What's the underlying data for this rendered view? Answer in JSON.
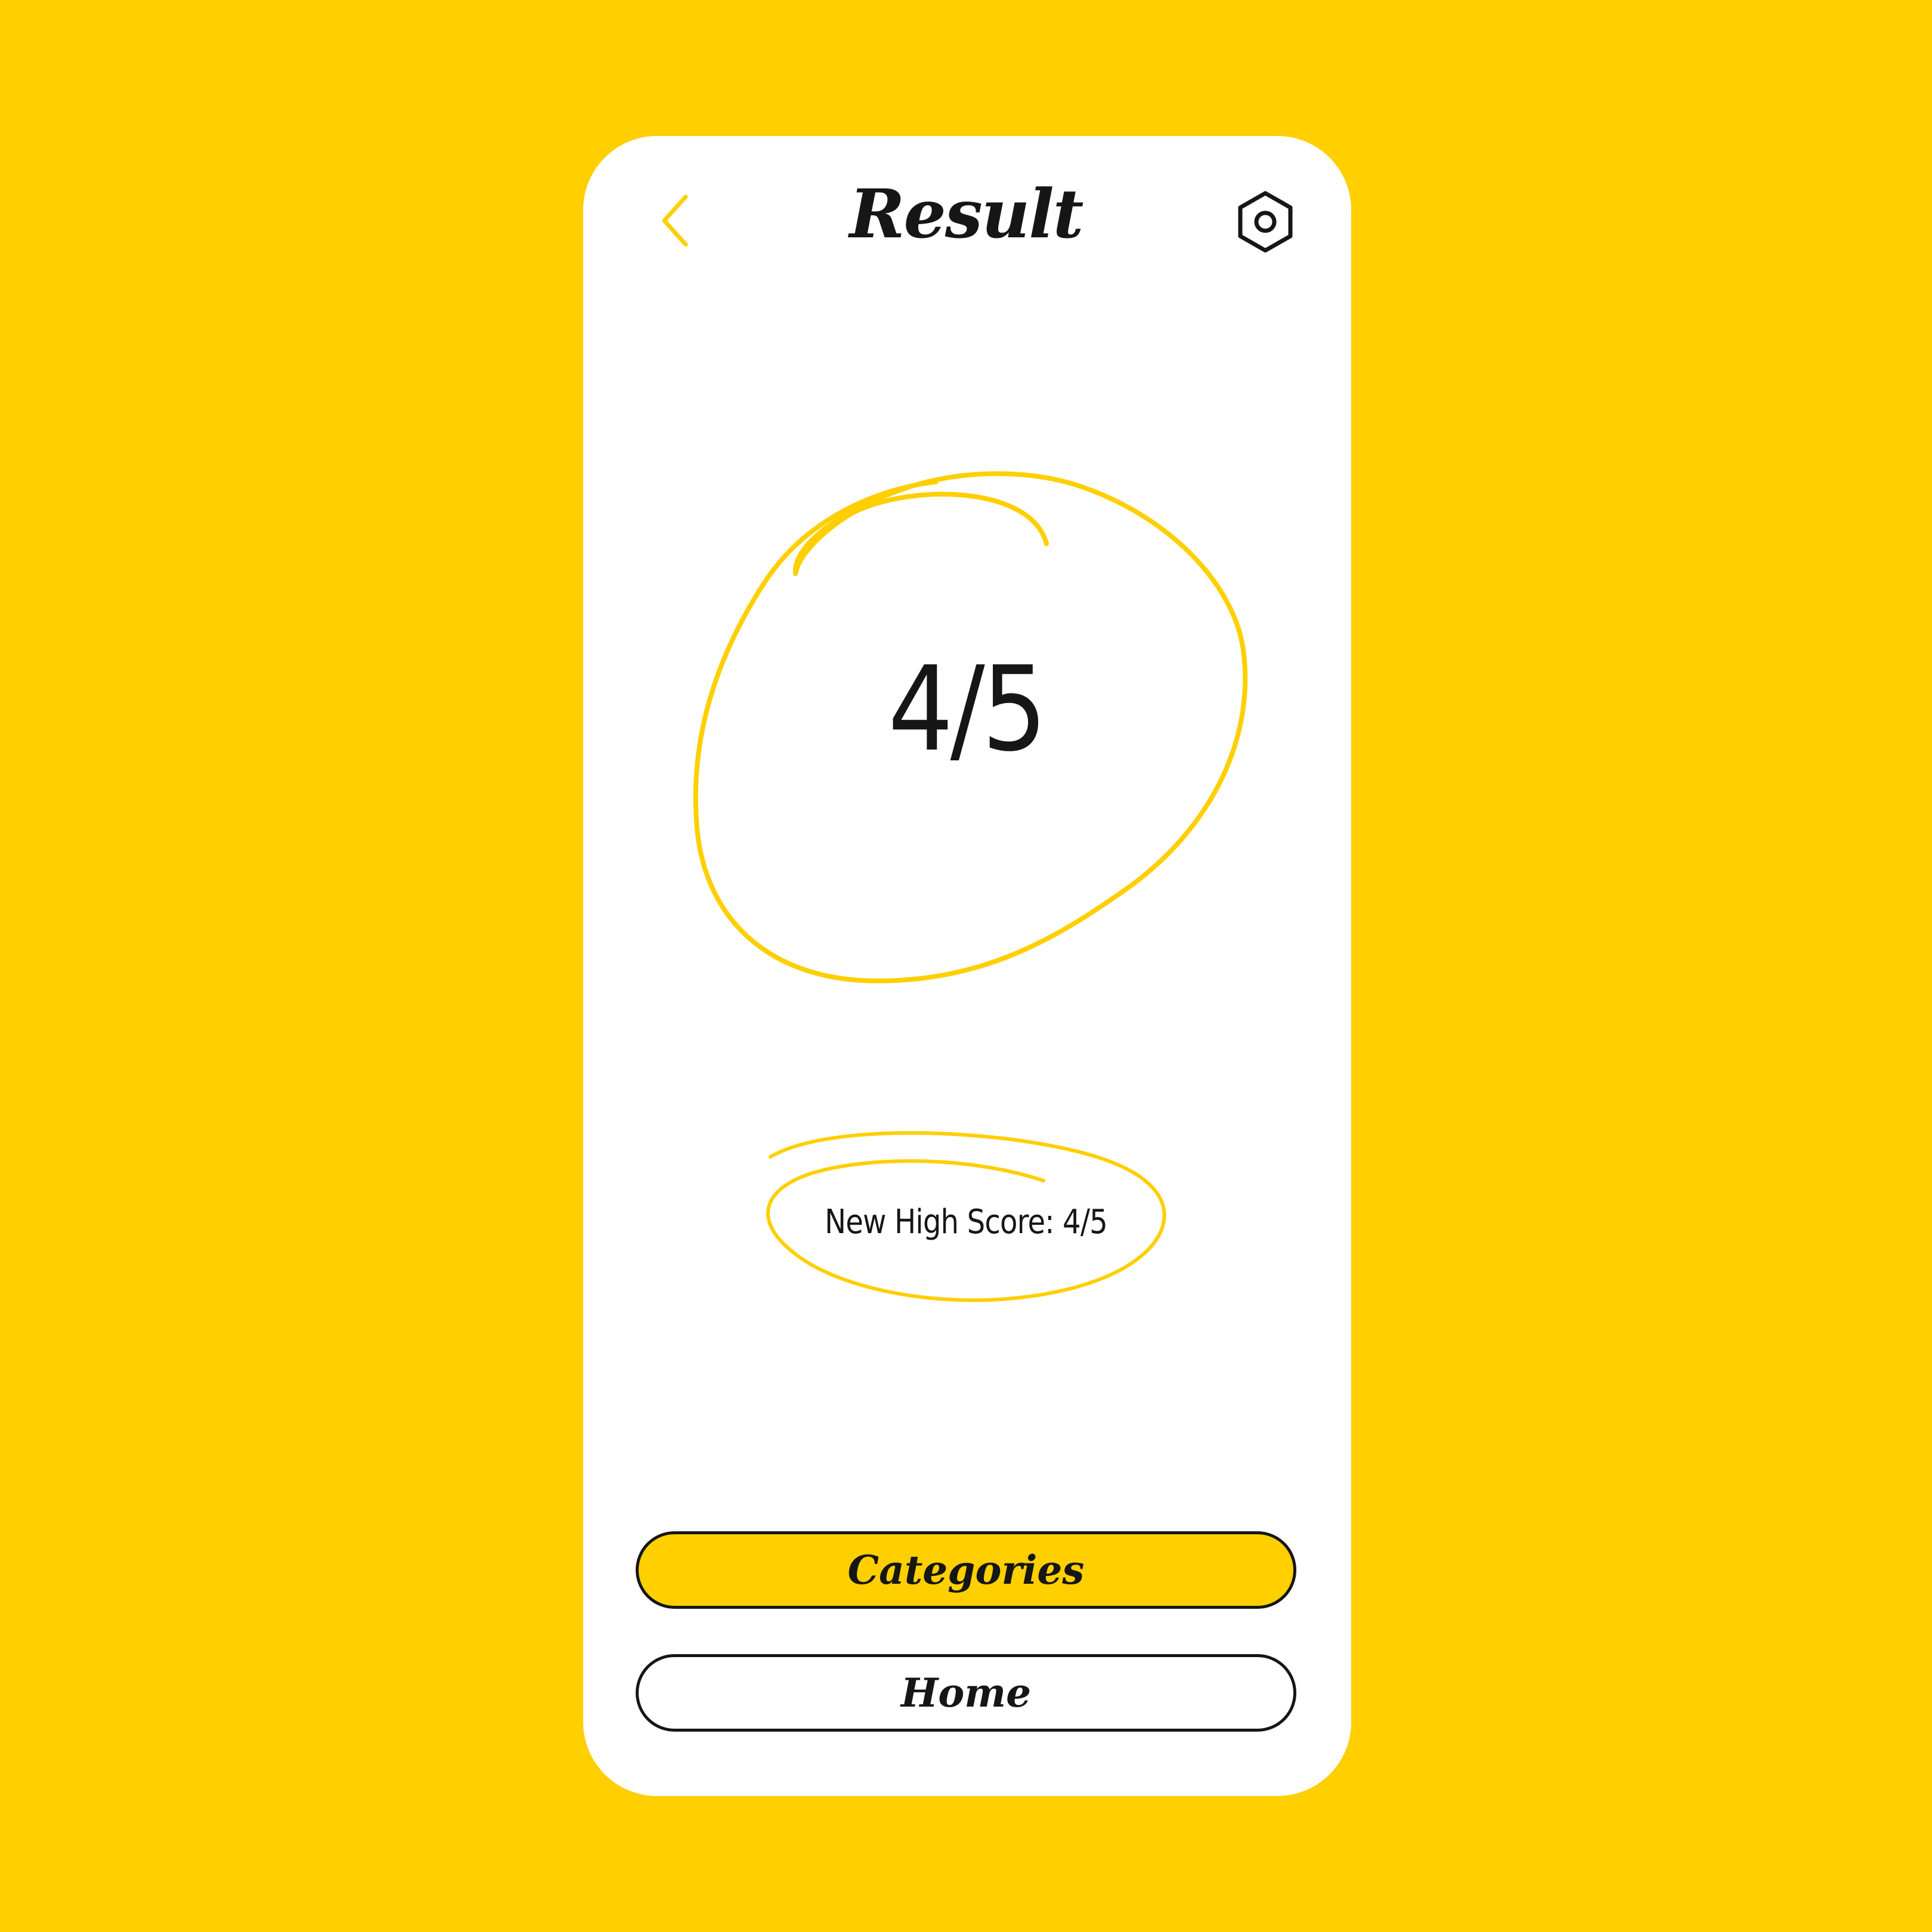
{
  "colors": {
    "background": "#FFCF00",
    "card": "#FFFFFF",
    "accent": "#FFCF00",
    "ink": "#161616"
  },
  "header": {
    "title": "Result",
    "back_icon": "chevron-left-icon",
    "settings_icon": "hexagon-gear-icon"
  },
  "score": {
    "value": "4/5"
  },
  "high_score": {
    "text": "New High Score: 4/5"
  },
  "buttons": {
    "categories": "Categories",
    "home": "Home"
  }
}
